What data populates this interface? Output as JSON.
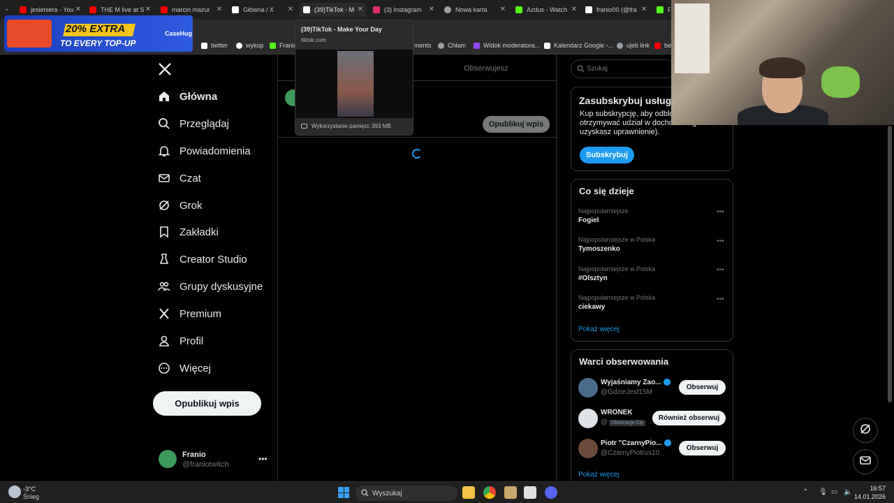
{
  "browser": {
    "tabs": [
      {
        "title": "jesieniera - You",
        "color": "#ff0000"
      },
      {
        "title": "THE M live at S",
        "color": "#ff0000"
      },
      {
        "title": "marcin mazur",
        "color": "#ff0000"
      },
      {
        "title": "Główna / X",
        "color": "#ffffff"
      },
      {
        "title": "(39)TikTok - M",
        "color": "#ffffff"
      },
      {
        "title": "(3) Instagram",
        "color": "#e1306c"
      },
      {
        "title": "Nowa karta",
        "color": "#9aa0a6"
      },
      {
        "title": "Azdus - Watch",
        "color": "#53fc18"
      },
      {
        "title": "franio00 (@fra",
        "color": "#ffffff"
      },
      {
        "title": "Fr",
        "color": "#53fc18"
      }
    ],
    "bookmarks": [
      {
        "label": "twitter",
        "color": "#ffffff"
      },
      {
        "label": "wykop",
        "color": "#ffffff"
      },
      {
        "label": "Franio",
        "color": "#53fc18"
      },
      {
        "label": "ments",
        "color": "#9aa0a6"
      },
      {
        "label": "Chłam",
        "color": "#9aa0a6"
      },
      {
        "label": "Widok moderatora...",
        "color": "#9146ff"
      },
      {
        "label": "Kalendarz Google -...",
        "color": "#ffffff"
      },
      {
        "label": "ujeb link",
        "color": "#9aa0a6"
      },
      {
        "label": "be",
        "color": "#ff0000"
      }
    ]
  },
  "ad": {
    "headline": "20% EXTRA",
    "sub": "TO EVERY TOP-UP",
    "brand": "CaseHug"
  },
  "tab_preview": {
    "title": "(39)TikTok - Make Your Day",
    "url": "tiktok.com",
    "memory": "Wykorzystanie pamięci: 393 MB"
  },
  "nav": {
    "items": [
      {
        "label": "Główna",
        "icon": "home-icon"
      },
      {
        "label": "Przeglądaj",
        "icon": "search-icon"
      },
      {
        "label": "Powiadomienia",
        "icon": "bell-icon"
      },
      {
        "label": "Czat",
        "icon": "mail-icon"
      },
      {
        "label": "Grok",
        "icon": "grok-icon"
      },
      {
        "label": "Zakładki",
        "icon": "bookmark-icon"
      },
      {
        "label": "Creator Studio",
        "icon": "creator-icon"
      },
      {
        "label": "Grupy dyskusyjne",
        "icon": "groups-icon"
      },
      {
        "label": "Premium",
        "icon": "x-icon"
      },
      {
        "label": "Profil",
        "icon": "profile-icon"
      },
      {
        "label": "Więcej",
        "icon": "more-icon"
      }
    ],
    "post_label": "Opublikuj wpis"
  },
  "account": {
    "name": "Franio",
    "handle": "@franiotwitch"
  },
  "center": {
    "tab_following": "Obserwujesz",
    "publish_label": "Opublikuj wpis"
  },
  "right": {
    "search_placeholder": "Szukaj",
    "subscribe": {
      "title": "Zasubskrybuj usługę",
      "desc": "Kup subskrypcję, aby odblok funkcje i otrzymywać udział w dochodach (jeśli uzyskasz uprawnienie).",
      "button": "Subskrybuj"
    },
    "trends": {
      "title": "Co się dzieje",
      "items": [
        {
          "category": "Najpopularniejsze",
          "name": "Fogiel"
        },
        {
          "category": "Najpopularniejsze w Polska",
          "name": "Tymoszenko"
        },
        {
          "category": "Najpopularniejsze w Polska",
          "name": "#Olsztyn"
        },
        {
          "category": "Najpopularniejsze w Polska",
          "name": "ciekawy"
        }
      ],
      "show_more": "Pokaż więcej"
    },
    "who_to_follow": {
      "title": "Warci obserwowania",
      "items": [
        {
          "name": "Wyjaśniamy Zao...",
          "handle": "@GdzieJest15M",
          "button": "Obserwuj",
          "verified": true,
          "follows_you": ""
        },
        {
          "name": "WRONEK",
          "handle": "@",
          "button": "Również obserwuj",
          "verified": false,
          "follows_you": "Obserwuje Cię"
        },
        {
          "name": "Piotr \"CzarnyPio...",
          "handle": "@CzarnyPiotrus10",
          "button": "Obserwuj",
          "verified": true,
          "follows_you": ""
        }
      ],
      "show_more": "Pokaż więcej"
    }
  },
  "taskbar": {
    "temp": "-3°C",
    "condition": "Śnieg",
    "search": "Wyszukaj",
    "time": "16:57",
    "date": "14.01.2026"
  }
}
